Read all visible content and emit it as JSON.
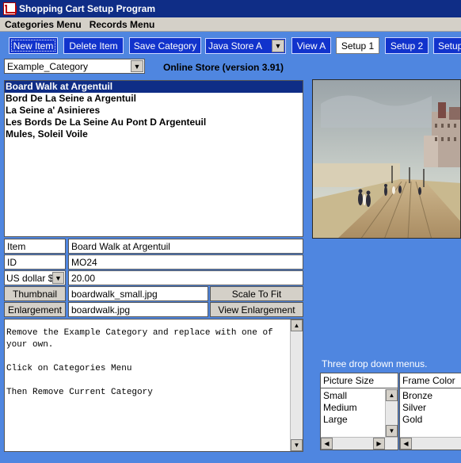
{
  "window": {
    "title": "Shopping Cart Setup Program"
  },
  "menubar": {
    "items": [
      "Categories Menu",
      "Records Menu"
    ]
  },
  "toolbar": {
    "new_item": "New Item",
    "delete_item": "Delete Item",
    "save_category": "Save Category",
    "store_select": "Java Store A",
    "view_a": "View A",
    "setup1": "Setup 1",
    "setup2": "Setup 2",
    "setup3": "Setup"
  },
  "category_select": "Example_Category",
  "store_title": "Online Store (version 3.91)",
  "items_list": [
    "Board Walk at Argentuil",
    "Bord De La Seine a Argentuil",
    "La Seine a' Asinieres",
    "Les Bords De La Seine Au Pont D Argenteuil",
    "Mules, Soleil Voile"
  ],
  "fields": {
    "item_label": "Item",
    "item_value": "Board Walk at Argentuil",
    "id_label": "ID",
    "id_value": "MO24",
    "currency_select": "US dollar $",
    "price_value": "20.00",
    "thumbnail_button": "Thumbnail",
    "thumbnail_value": "boardwalk_small.jpg",
    "scale_button": "Scale To Fit",
    "enlargement_button": "Enlargement",
    "enlargement_value": "boardwalk.jpg",
    "view_enlargement_button": "View Enlargement"
  },
  "notes_text": "Remove the Example Category and replace with one of your own.\n\nClick on Categories Menu\n\nThen Remove Current Category",
  "dropdowns_note": "Three drop down menus.",
  "picture_size": {
    "header": "Picture Size",
    "options": [
      "Small",
      "Medium",
      "Large"
    ]
  },
  "frame_color": {
    "header": "Frame Color",
    "options": [
      "Bronze",
      "Silver",
      "Gold"
    ]
  },
  "colors": {
    "background": "#4f86e0",
    "button_blue": "#1133cc",
    "titlebar": "#0f2d86"
  }
}
